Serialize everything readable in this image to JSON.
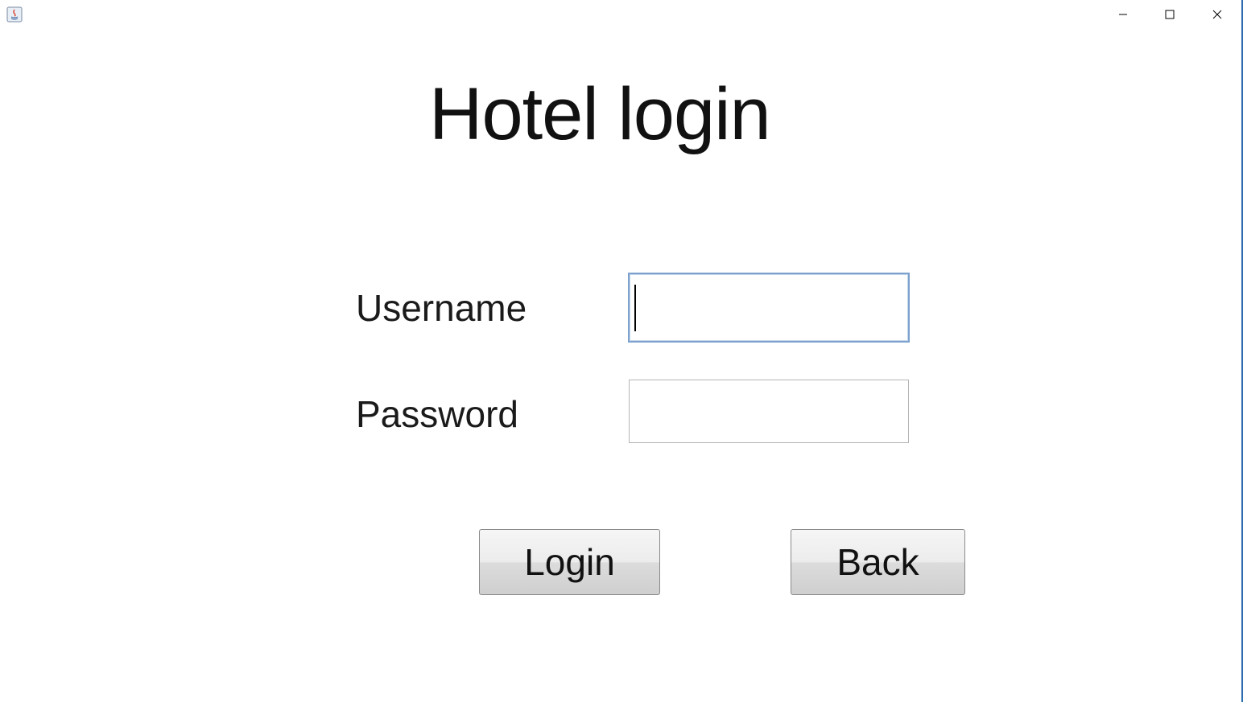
{
  "window": {
    "controls": {
      "minimize_icon": "minimize-icon",
      "maximize_icon": "maximize-icon",
      "close_icon": "close-icon"
    },
    "app_icon": "java-icon",
    "accent_color": "#2b6cb0"
  },
  "main": {
    "title": "Hotel login",
    "username_label": "Username",
    "username_value": "",
    "password_label": "Password",
    "password_value": "",
    "login_label": "Login",
    "back_label": "Back"
  }
}
